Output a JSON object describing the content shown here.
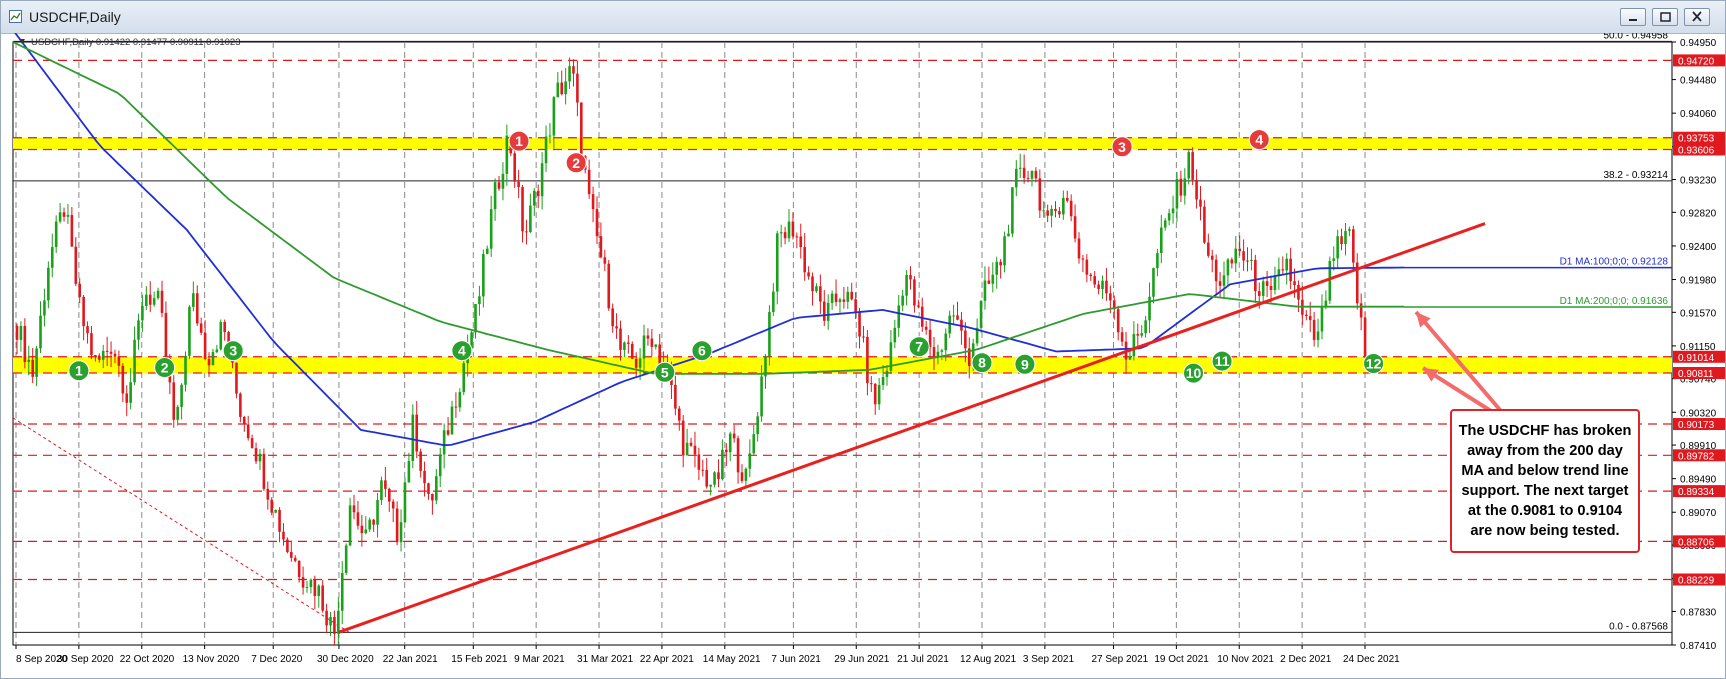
{
  "window": {
    "title": "USDCHF,Daily",
    "minimize_icon": "minimize-icon",
    "restore_icon": "restore-icon",
    "close_icon": "close-icon"
  },
  "chart_data": {
    "type": "candlestick",
    "symbol_label": "USDCHF,Daily  0.91422 0.91477 0.90911 0.91023",
    "x_ticks": [
      "8 Sep 2020",
      "30 Sep 2020",
      "22 Oct 2020",
      "13 Nov 2020",
      "7 Dec 2020",
      "30 Dec 2020",
      "22 Jan 2021",
      "15 Feb 2021",
      "9 Mar 2021",
      "31 Mar 2021",
      "22 Apr 2021",
      "14 May 2021",
      "7 Jun 2021",
      "29 Jun 2021",
      "21 Jul 2021",
      "12 Aug 2021",
      "3 Sep 2021",
      "27 Sep 2021",
      "19 Oct 2021",
      "10 Nov 2021",
      "2 Dec 2021",
      "24 Dec 2021"
    ],
    "y_ticks": [
      "0.94950",
      "0.94480",
      "0.94060",
      "0.93640",
      "0.93230",
      "0.92820",
      "0.92400",
      "0.91980",
      "0.91570",
      "0.91150",
      "0.90740",
      "0.90320",
      "0.89910",
      "0.89490",
      "0.89070",
      "0.88660",
      "0.88240",
      "0.87830",
      "0.87410"
    ],
    "ylim": [
      0.8741,
      0.9495
    ],
    "close_path": [
      0.914,
      0.908,
      0.9222,
      0.929,
      0.9155,
      0.909,
      0.912,
      0.905,
      0.9185,
      0.9165,
      0.9,
      0.918,
      0.91,
      0.914,
      0.904,
      0.899,
      0.8925,
      0.8865,
      0.883,
      0.881,
      0.8755,
      0.892,
      0.887,
      0.894,
      0.888,
      0.902,
      0.891,
      0.9,
      0.908,
      0.916,
      0.929,
      0.938,
      0.925,
      0.933,
      0.943,
      0.946,
      0.93,
      0.921,
      0.911,
      0.9095,
      0.913,
      0.908,
      0.8995,
      0.896,
      0.894,
      0.9,
      0.8945,
      0.908,
      0.925,
      0.9265,
      0.9195,
      0.915,
      0.9185,
      0.915,
      0.904,
      0.91,
      0.921,
      0.914,
      0.91,
      0.916,
      0.91,
      0.918,
      0.922,
      0.932,
      0.934,
      0.926,
      0.931,
      0.923,
      0.919,
      0.918,
      0.91,
      0.914,
      0.924,
      0.93,
      0.935,
      0.923,
      0.919,
      0.924,
      0.92,
      0.917,
      0.9225,
      0.915,
      0.912,
      0.923,
      0.925,
      0.9102
    ],
    "ma100_path": [
      0.951,
      0.9365,
      0.926,
      0.912,
      0.901,
      0.899,
      0.902,
      0.907,
      0.9105,
      0.915,
      0.916,
      0.9138,
      0.9108,
      0.9112,
      0.9192,
      0.9212,
      0.9213
    ],
    "ma200_path": [
      0.9495,
      0.943,
      0.93,
      0.92,
      0.9145,
      0.911,
      0.908,
      0.908,
      0.9085,
      0.911,
      0.9155,
      0.918,
      0.9164,
      0.9164
    ],
    "levels": [
      {
        "label": "50.0 - 0.94958",
        "value": 0.94958,
        "style": "solid"
      },
      {
        "label": "0.94720",
        "value": 0.9472,
        "style": "dashed"
      },
      {
        "label": "0.93753",
        "value": 0.93753,
        "style": "band"
      },
      {
        "label": "0.93606",
        "value": 0.93606,
        "style": "band"
      },
      {
        "label": "38.2 - 0.93214",
        "value": 0.93214,
        "style": "solid"
      },
      {
        "label": "D1 MA:100;0;0; 0.92128",
        "value": 0.92128,
        "style": "ma100"
      },
      {
        "label": "D1 MA:200;0;0; 0.91636",
        "value": 0.91636,
        "style": "ma200"
      },
      {
        "label": "0.91014",
        "value": 0.91014,
        "style": "band"
      },
      {
        "label": "0.90811",
        "value": 0.90811,
        "style": "band"
      },
      {
        "label": "0.90173",
        "value": 0.90173,
        "style": "dashed"
      },
      {
        "label": "0.89782",
        "value": 0.89782,
        "style": "dashed"
      },
      {
        "label": "0.89334",
        "value": 0.89334,
        "style": "dashed"
      },
      {
        "label": "0.88706",
        "value": 0.88706,
        "style": "dashed"
      },
      {
        "label": "0.88229",
        "value": 0.88229,
        "style": "dashed"
      },
      {
        "label": "0.0 - 0.87568",
        "value": 0.87568,
        "style": "solid"
      }
    ],
    "bands": [
      [
        0.93606,
        0.93753
      ],
      [
        0.90811,
        0.91014
      ]
    ],
    "trendline": {
      "start": [
        "30 Dec 2020",
        0.8757
      ],
      "end": [
        "4 Feb 2022",
        0.9268
      ]
    },
    "red_markers": [
      {
        "label": "1",
        "date": "3 Mar 2021",
        "value": 0.9371
      },
      {
        "label": "2",
        "date": "23 Mar 2021",
        "value": 0.9344
      },
      {
        "label": "3",
        "date": "30 Sep 2021",
        "value": 0.9364
      },
      {
        "label": "4",
        "date": "17 Nov 2021",
        "value": 0.9373
      }
    ],
    "green_markers": [
      {
        "label": "1",
        "date": "30 Sep 2020",
        "value": 0.9084
      },
      {
        "label": "2",
        "date": "30 Oct 2020",
        "value": 0.9088
      },
      {
        "label": "3",
        "date": "23 Nov 2020",
        "value": 0.9109
      },
      {
        "label": "4",
        "date": "11 Feb 2021",
        "value": 0.9109
      },
      {
        "label": "5",
        "date": "23 Apr 2021",
        "value": 0.9082
      },
      {
        "label": "6",
        "date": "6 May 2021",
        "value": 0.9109
      },
      {
        "label": "7",
        "date": "21 Jul 2021",
        "value": 0.9114
      },
      {
        "label": "8",
        "date": "12 Aug 2021",
        "value": 0.9094
      },
      {
        "label": "9",
        "date": "27 Aug 2021",
        "value": 0.9092
      },
      {
        "label": "10",
        "date": "25 Oct 2021",
        "value": 0.9081
      },
      {
        "label": "11",
        "date": "4 Nov 2021",
        "value": 0.9096
      },
      {
        "label": "12",
        "date": "27 Dec 2021",
        "value": 0.9093
      }
    ],
    "annotation": "The USDCHF has broken away from the 200 day MA and below trend line support. The next target at the 0.9081 to 0.9104 are now being tested.",
    "colors": {
      "bull": "#1aa01a",
      "bear": "#e0191f",
      "ma100": "#1f2fd6",
      "ma200": "#2f9a2f",
      "band": "#ffff00",
      "trend": "#e8211f",
      "green_marker": "#2aa12f",
      "red_marker": "#e63b3b"
    }
  }
}
